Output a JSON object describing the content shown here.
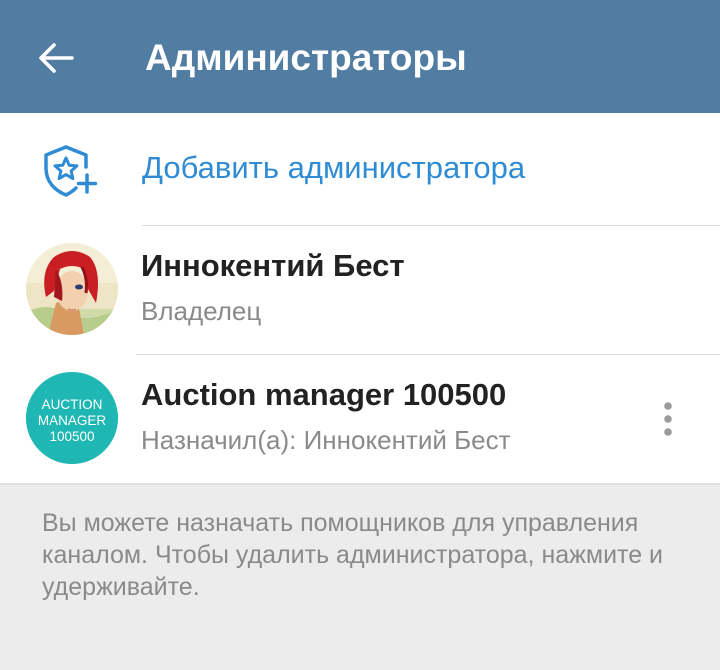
{
  "header": {
    "title": "Администраторы",
    "back_icon": "arrow-left-icon",
    "background_color": "#527da3"
  },
  "add_admin": {
    "label": "Добавить администратора",
    "icon": "shield-star-plus-icon",
    "accent_color": "#2f8cd4"
  },
  "admins": [
    {
      "name": "Иннокентий Бест",
      "subtitle": "Владелец",
      "avatar": "photo-avatar-red-hair"
    },
    {
      "name": "Auction manager 100500",
      "subtitle": "Назначил(а): Иннокентий Бест",
      "avatar_text": [
        "AUCTION",
        "MANAGER",
        "100500"
      ],
      "avatar_color": "#1fb7b4",
      "menu_icon": "more-vertical-icon"
    }
  ],
  "footer_hint": "Вы можете назначать помощников для управления каналом. Чтобы удалить администратора, нажмите и удерживайте."
}
